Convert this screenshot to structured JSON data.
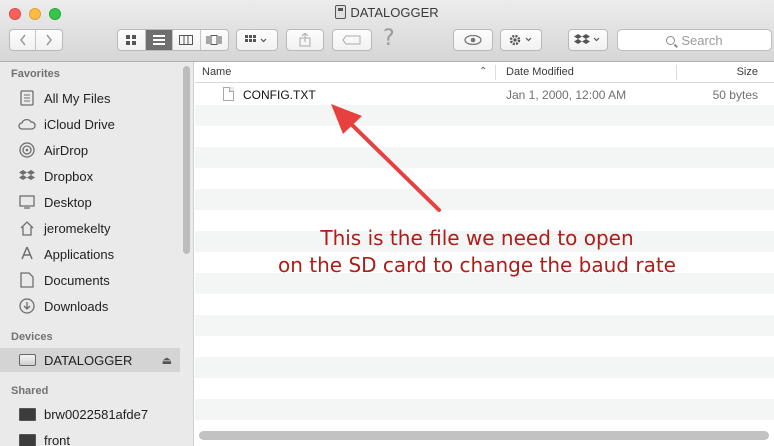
{
  "window": {
    "title": "DATALOGGER"
  },
  "toolbar": {
    "search_placeholder": "Search"
  },
  "sidebar": {
    "favorites_header": "Favorites",
    "favorites": [
      {
        "label": "All My Files",
        "icon": "all-files-icon"
      },
      {
        "label": "iCloud Drive",
        "icon": "cloud-icon"
      },
      {
        "label": "AirDrop",
        "icon": "airdrop-icon"
      },
      {
        "label": "Dropbox",
        "icon": "dropbox-icon"
      },
      {
        "label": "Desktop",
        "icon": "desktop-icon"
      },
      {
        "label": "jeromekelty",
        "icon": "home-icon"
      },
      {
        "label": "Applications",
        "icon": "applications-icon"
      },
      {
        "label": "Documents",
        "icon": "documents-icon"
      },
      {
        "label": "Downloads",
        "icon": "downloads-icon"
      }
    ],
    "devices_header": "Devices",
    "devices": [
      {
        "label": "DATALOGGER",
        "icon": "drive-icon",
        "selected": true
      }
    ],
    "shared_header": "Shared",
    "shared": [
      {
        "label": "brw0022581afde7",
        "icon": "monitor-icon"
      },
      {
        "label": "front",
        "icon": "monitor-icon"
      }
    ]
  },
  "columns": {
    "name": "Name",
    "date": "Date Modified",
    "size": "Size"
  },
  "files": [
    {
      "name": "CONFIG.TXT",
      "date": "Jan 1, 2000, 12:00 AM",
      "size": "50 bytes"
    }
  ],
  "annotation": {
    "line1": "This is the file we need to open",
    "line2": "on the SD card to change the baud rate",
    "color": "#b01c17",
    "arrow_color": "#e8403f"
  }
}
